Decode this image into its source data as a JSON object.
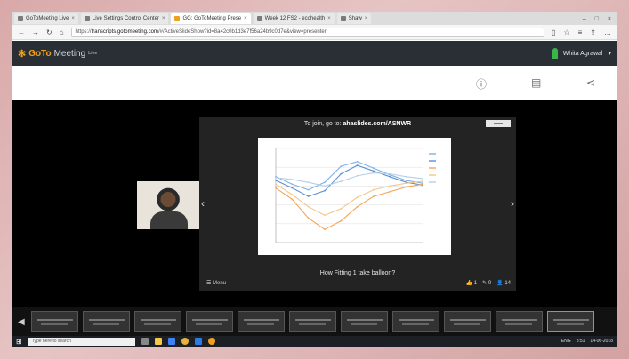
{
  "browser": {
    "tabs": [
      {
        "label": "GoToMeeting Live",
        "active": false
      },
      {
        "label": "Live Settings Control Center",
        "active": false
      },
      {
        "label": "GG: GoToMeeting Prese",
        "active": true
      },
      {
        "label": "Week 12 FS2 - ecohealth",
        "active": false
      },
      {
        "label": "Shaw",
        "active": false
      }
    ],
    "url_prefix": "https://",
    "url_host": "transcripts.gotomeeting.com",
    "url_rest": "/#/ActiveSlideShow?id=8a42c0b1d3e7f56a24b9c0d7e&view=presenter",
    "window_controls": [
      "–",
      "□",
      "×"
    ]
  },
  "app": {
    "logo_go": "GoTo",
    "logo_meeting": "Meeting",
    "logo_sub": "Live",
    "user_name": "Whita Agrawal"
  },
  "slide": {
    "join_text": "To join, go to:",
    "join_url": "ahaslides.com/ASNWR",
    "question": "How Fitting 1 take balloon?",
    "menu_label": "Menu",
    "stats": {
      "likes": "1",
      "comments": "0",
      "participants": "14"
    }
  },
  "chart_data": {
    "type": "line",
    "title": "",
    "xlabel": "",
    "ylabel": "",
    "x": [
      0,
      1,
      2,
      3,
      4,
      5,
      6,
      7,
      8,
      9
    ],
    "xlim": [
      0,
      9
    ],
    "ylim": [
      0,
      10
    ],
    "series": [
      {
        "color": "#7fb2e5",
        "values": [
          7.0,
          6.2,
          5.6,
          6.4,
          8.1,
          8.6,
          7.9,
          7.2,
          6.6,
          6.3
        ]
      },
      {
        "color": "#5b8fd6",
        "values": [
          6.6,
          5.8,
          4.9,
          5.5,
          7.3,
          8.2,
          7.6,
          7.0,
          6.4,
          6.1
        ]
      },
      {
        "color": "#f2a65a",
        "values": [
          5.8,
          4.6,
          2.6,
          1.4,
          2.3,
          3.8,
          4.9,
          5.4,
          5.9,
          6.2
        ]
      },
      {
        "color": "#f5c68a",
        "values": [
          6.2,
          5.1,
          3.8,
          2.9,
          3.6,
          4.8,
          5.6,
          6.0,
          6.3,
          6.5
        ]
      },
      {
        "color": "#b7cfe6",
        "values": [
          6.9,
          6.7,
          6.4,
          6.0,
          6.5,
          7.1,
          7.4,
          7.3,
          7.0,
          6.8
        ]
      }
    ]
  },
  "taskbar": {
    "search_placeholder": "Type here to search",
    "time": "8:51",
    "date": "14-06-2018",
    "lang": "ENG"
  }
}
